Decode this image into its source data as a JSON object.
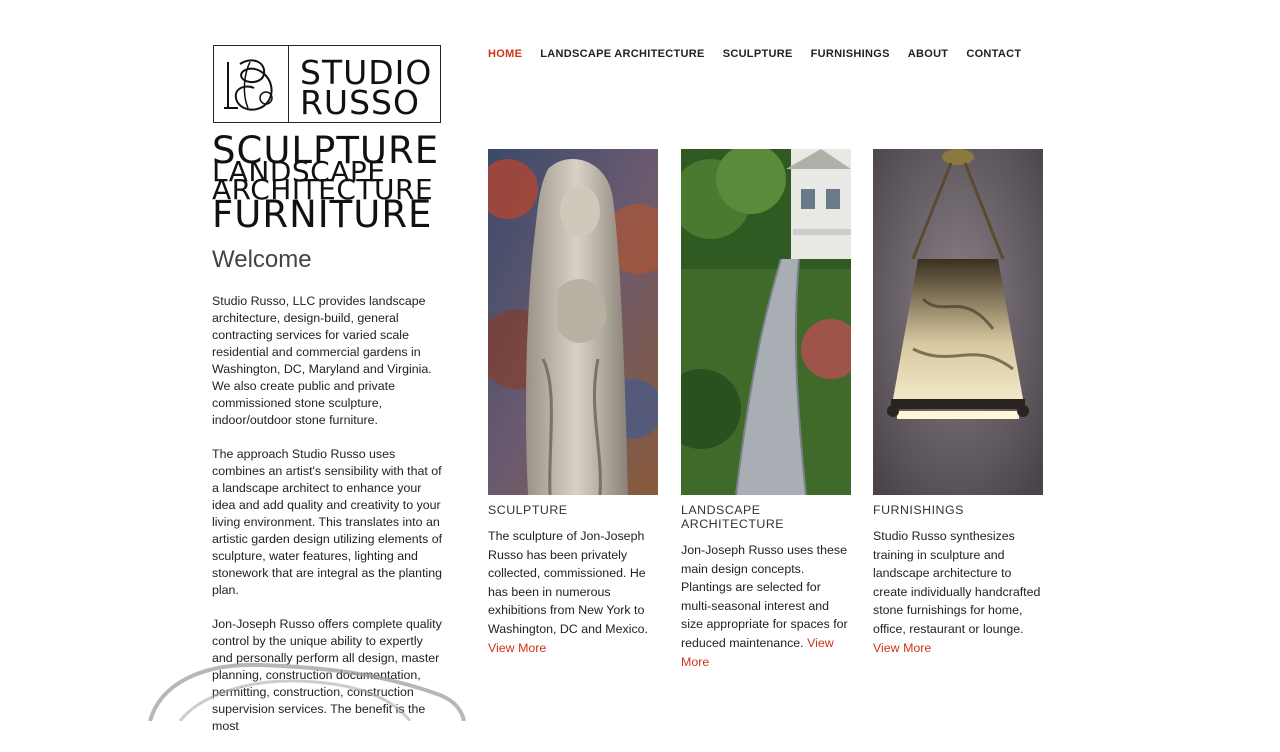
{
  "logo": {
    "word1": "STUDIO",
    "word2": "RUSSO"
  },
  "tagline": [
    "SCULPTURE",
    "LANDSCAPE",
    "ARCHITECTURE",
    "FURNITURE"
  ],
  "nav": [
    {
      "label": "HOME",
      "active": true
    },
    {
      "label": "LANDSCAPE ARCHITECTURE"
    },
    {
      "label": "SCULPTURE"
    },
    {
      "label": "FURNISHINGS"
    },
    {
      "label": "ABOUT"
    },
    {
      "label": "CONTACT"
    }
  ],
  "welcome": {
    "title": "Welcome",
    "paragraphs": [
      "Studio Russo, LLC provides landscape architecture, design-build, general contracting services for varied scale residential and commercial gardens in Washington, DC, Maryland and Virginia. We also create public and private commissioned stone sculpture, indoor/outdoor stone furniture.",
      "The approach Studio Russo uses combines an artist's sensibility with that of a landscape architect to enhance your idea and add quality and creativity to your living environment. This translates into an artistic garden design utilizing elements of sculpture, water features, lighting and stonework that are integral as the planting plan.",
      "Jon-Joseph Russo offers complete quality control by the unique ability to expertly and personally perform all design, master planning, construction documentation, permitting, construction, construction supervision services. The benefit is the most"
    ]
  },
  "cards": [
    {
      "title": "SCULPTURE",
      "text": "The sculpture of Jon-Joseph Russo has been privately collected, commissioned. He has been in numerous exhibitions from New York to Washington, DC and Mexico.",
      "link": "View More",
      "image": "madonna-statue-photo"
    },
    {
      "title": "LANDSCAPE ARCHITECTURE",
      "text": "Jon-Joseph Russo uses these main design concepts. Plantings are selected for multi-seasonal interest and size appropriate for spaces for reduced maintenance.",
      "link": "View More",
      "image": "stone-path-garden-photo"
    },
    {
      "title": "FURNISHINGS",
      "text": "Studio Russo synthesizes training in sculpture and landscape architecture to create individually handcrafted stone furnishings for home, office, restaurant or lounge.",
      "link": "View More",
      "image": "pendant-lamp-photo"
    }
  ],
  "colors": {
    "accent": "#d0331b",
    "text": "#222222"
  }
}
